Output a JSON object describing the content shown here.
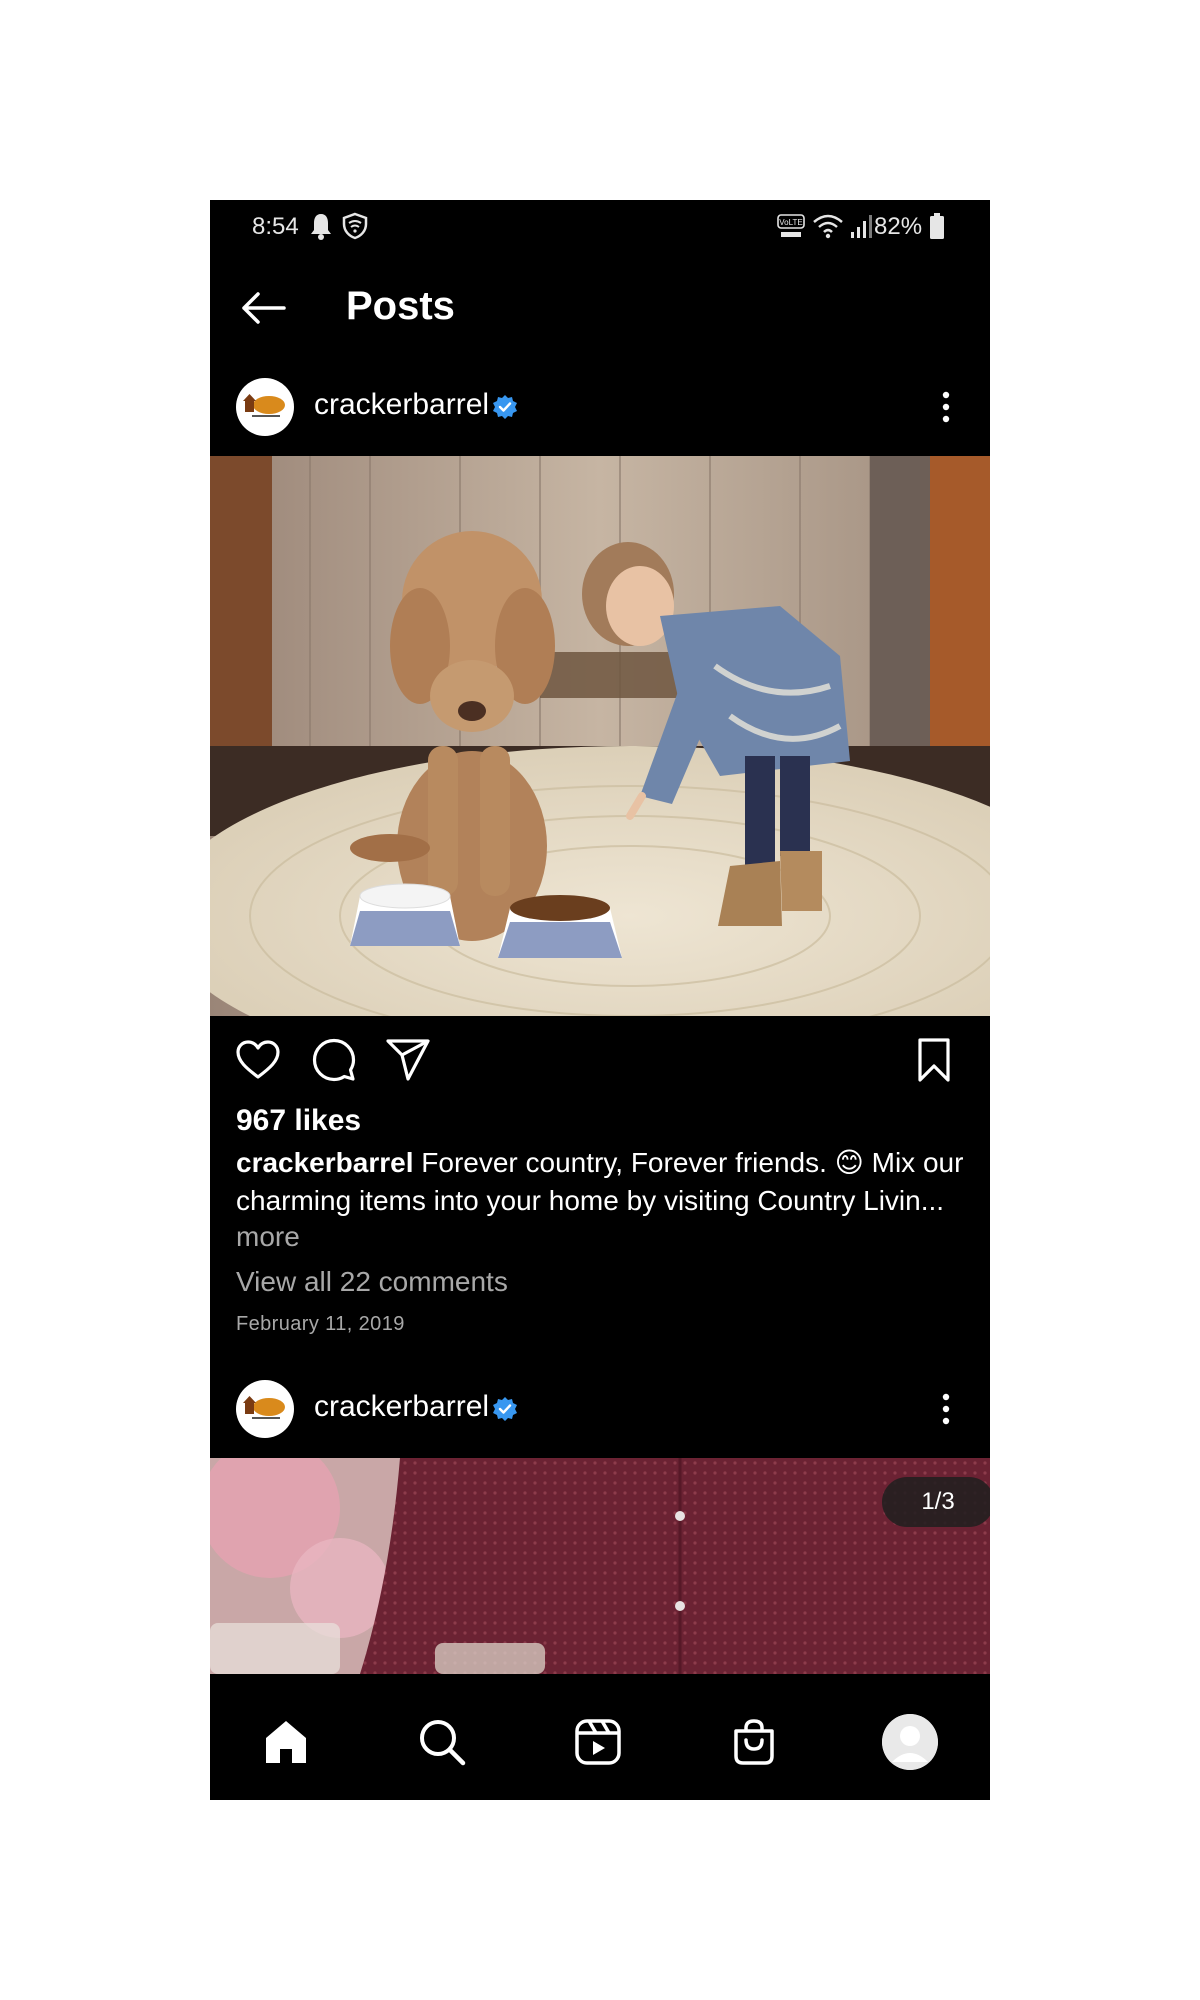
{
  "status_bar": {
    "time": "8:54",
    "battery_percent": "82%",
    "icons": [
      "bell-icon",
      "shield-icon",
      "volte-icon",
      "wifi-icon",
      "signal-icon",
      "battery-icon"
    ]
  },
  "header": {
    "title": "Posts",
    "back_icon": "arrow-left-icon"
  },
  "posts": [
    {
      "username": "crackerbarrel",
      "verified": true,
      "likes": "967 likes",
      "caption_user": "crackerbarrel",
      "caption_text": "Forever country, Forever friends. 😊 Mix our charming items into your home by visiting Country Livin...",
      "more_label": "more",
      "comments_link": "View all 22 comments",
      "date": "February 11, 2019"
    },
    {
      "username": "crackerbarrel",
      "verified": true,
      "carousel_counter": "1/3"
    }
  ],
  "actions": [
    "heart-icon",
    "comment-icon",
    "paper-plane-icon",
    "bookmark-icon"
  ],
  "bottom_nav": [
    "home-icon",
    "search-icon",
    "reels-icon",
    "shopping-bag-icon",
    "profile-avatar"
  ],
  "colors": {
    "background": "#000000",
    "text": "#ffffff",
    "muted": "#a8a8a8",
    "verified": "#3897f0"
  }
}
